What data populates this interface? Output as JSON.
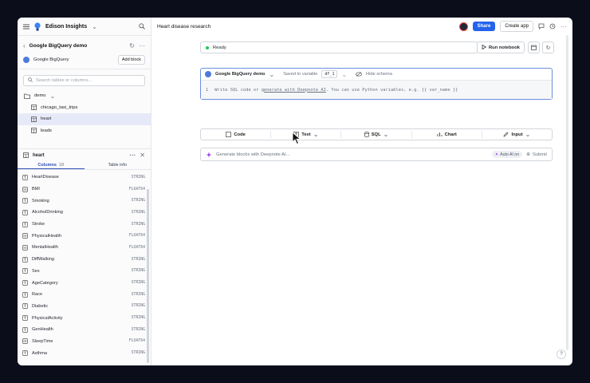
{
  "sidebar": {
    "workspace_name": "Edison Insights",
    "integration_title": "Google BigQuery demo",
    "integration_name": "Google BigQuery",
    "add_block_label": "Add block",
    "search_placeholder": "Search tables or columns...",
    "tree": {
      "dataset": "demo",
      "tables": [
        "chicago_taxi_trips",
        "heart",
        "leads"
      ],
      "active_table": "heart"
    },
    "table_panel": {
      "title": "heart",
      "tabs": {
        "columns_label": "Columns",
        "columns_count": "18",
        "info_label": "Table info"
      },
      "columns": [
        {
          "name": "HeartDisease",
          "type": "STRING"
        },
        {
          "name": "BMI",
          "type": "FLOAT64"
        },
        {
          "name": "Smoking",
          "type": "STRING"
        },
        {
          "name": "AlcoholDrinking",
          "type": "STRING"
        },
        {
          "name": "Stroke",
          "type": "STRING"
        },
        {
          "name": "PhysicalHealth",
          "type": "FLOAT64"
        },
        {
          "name": "MentalHealth",
          "type": "FLOAT64"
        },
        {
          "name": "DiffWalking",
          "type": "STRING"
        },
        {
          "name": "Sex",
          "type": "STRING"
        },
        {
          "name": "AgeCategory",
          "type": "STRING"
        },
        {
          "name": "Race",
          "type": "STRING"
        },
        {
          "name": "Diabetic",
          "type": "STRING"
        },
        {
          "name": "PhysicalActivity",
          "type": "STRING"
        },
        {
          "name": "GenHealth",
          "type": "STRING"
        },
        {
          "name": "SleepTime",
          "type": "FLOAT64"
        },
        {
          "name": "Asthma",
          "type": "STRING"
        }
      ]
    }
  },
  "header": {
    "title": "Heart disease research",
    "share_label": "Share",
    "create_app_label": "Create app"
  },
  "notebook": {
    "status": "Ready",
    "run_label": "Run notebook",
    "sql_block": {
      "integration": "Google BigQuery demo",
      "saved_to_label": "Saved to variable",
      "variable": "df_1",
      "hide_schema_label": "Hide schema",
      "line_number": "1",
      "placeholder_pre": "Write SQL code or",
      "placeholder_link": "generate with Deepnote AI",
      "placeholder_post": ". You can use Python variables, e.g. {{ var_name }}"
    },
    "toolbar": [
      "Code",
      "Text",
      "SQL",
      "Chart",
      "Input"
    ],
    "ai_bar": {
      "placeholder": "Generate blocks with Deepnote AI...",
      "auto_ai_label": "Auto AI on",
      "submit_label": "Submit"
    }
  },
  "colors": {
    "accent": "#2563eb",
    "active_row": "#e6eaf8",
    "ai_purple": "#9333ea"
  }
}
